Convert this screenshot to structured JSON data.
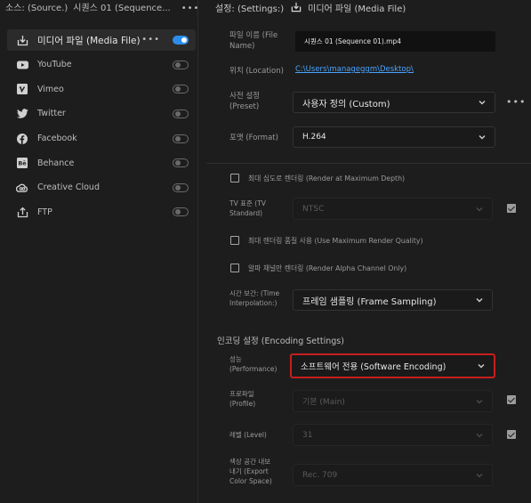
{
  "left_panel": {
    "header": {
      "source_label": "소스: (Source.)",
      "sequence_label": "시퀀스 01 (Sequence...",
      "more": "•••"
    },
    "destinations": [
      {
        "label": "미디어 파일 (Media File)",
        "selected": true,
        "enabled": true,
        "icon": "export-icon",
        "more": "•••"
      },
      {
        "label": "YouTube",
        "selected": false,
        "enabled": false,
        "icon": "youtube-icon"
      },
      {
        "label": "Vimeo",
        "selected": false,
        "enabled": false,
        "icon": "vimeo-icon"
      },
      {
        "label": "Twitter",
        "selected": false,
        "enabled": false,
        "icon": "twitter-icon"
      },
      {
        "label": "Facebook",
        "selected": false,
        "enabled": false,
        "icon": "facebook-icon"
      },
      {
        "label": "Behance",
        "selected": false,
        "enabled": false,
        "icon": "behance-icon"
      },
      {
        "label": "Creative Cloud",
        "selected": false,
        "enabled": false,
        "icon": "creative-cloud-icon"
      },
      {
        "label": "FTP",
        "selected": false,
        "enabled": false,
        "icon": "ftp-upload-icon"
      }
    ]
  },
  "right_panel": {
    "header": {
      "settings_label": "설정: (Settings:)",
      "media_file_label": "미디어 파일 (Media File)"
    },
    "file_name": {
      "label_line1": "파일 이름 (File",
      "label_line2": "Name)",
      "value": "시퀀스 01 (Sequence 01).mp4"
    },
    "location": {
      "label": "위치 (Location)",
      "value": "C:\\Users\\manageggm\\Desktop\\"
    },
    "preset": {
      "label_line1": "사전 설정",
      "label_line2": "(Preset)",
      "value": "사용자 정의 (Custom)",
      "more": "•••"
    },
    "format": {
      "label": "포맷 (Format)",
      "value": "H.264"
    },
    "render_max_depth": {
      "label": "최대 심도로 렌더링 (Render at Maximum Depth)",
      "checked": false
    },
    "tv_standard": {
      "label_line1": "TV 표준 (TV",
      "label_line2": "Standard)",
      "value": "NTSC",
      "checked": true
    },
    "max_render_quality": {
      "label": "최대 렌더링 품질 사용 (Use Maximum Render Quality)",
      "checked": false
    },
    "render_alpha": {
      "label": "알파 채널만 렌더링 (Render Alpha Channel Only)",
      "checked": false
    },
    "time_interpolation": {
      "label_line1": "시간 보간: (Time",
      "label_line2": "Interpolation:)",
      "value": "프레임 샘플링 (Frame Sampling)"
    },
    "encoding_settings": {
      "title": "인코딩 설정 (Encoding Settings)"
    },
    "performance": {
      "label_line1": "성능",
      "label_line2": "(Performance)",
      "value": "소프트웨어 전용 (Software Encoding)"
    },
    "profile": {
      "label_line1": "프로파일",
      "label_line2": "(Profile)",
      "value": "기본 (Main)",
      "checked": true
    },
    "level": {
      "label": "레벨 (Level)",
      "value": "31",
      "checked": true
    },
    "color_space": {
      "label_line1": "색상 공간 내보",
      "label_line2": "내기 (Export",
      "label_line3": "Color Space)",
      "value": "Rec. 709"
    }
  },
  "colors": {
    "accent": "#2d8ceb",
    "highlight_border": "#c81e1e",
    "link": "#4aa3ff"
  }
}
